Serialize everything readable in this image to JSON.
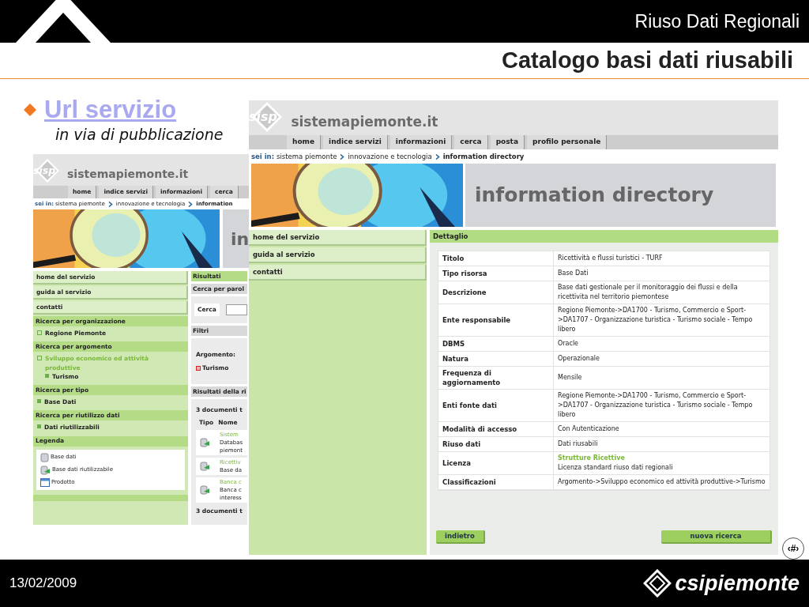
{
  "slide": {
    "header": "Riuso Dati Regionali",
    "title": "Catalogo basi dati riusabili",
    "bullet": {
      "link": "Url servizio",
      "note": "in via di pubblicazione"
    },
    "page_number": "‹#›",
    "date": "13/02/2009",
    "logo": "csipiemonte"
  },
  "back_page": {
    "logo_text": "sisp",
    "site_name": "sistemapiemonte.it",
    "nav": [
      "home",
      "indice servizi",
      "informazioni",
      "cerca"
    ],
    "breadcrumb": {
      "label": "sei in:",
      "items": [
        "sistema piemonte",
        "innovazione e tecnologia",
        "information"
      ]
    },
    "banner_title": "in",
    "menu": [
      "home del servizio",
      "guida al servizio",
      "contatti"
    ],
    "sections": [
      {
        "title": "Ricerca per organizzazione",
        "items": [
          {
            "label": "Regione Piemonte",
            "kind": "tree"
          }
        ]
      },
      {
        "title": "Ricerca per argomento",
        "items": [
          {
            "label": "Sviluppo economico ed attività produttive",
            "kind": "tree",
            "children": [
              {
                "label": "Turismo",
                "kind": "leaf"
              }
            ]
          }
        ]
      },
      {
        "title": "Ricerca per tipo",
        "items": [
          {
            "label": "Base Dati",
            "kind": "leaf"
          }
        ]
      },
      {
        "title": "Ricerca per riutilizzo dati",
        "items": [
          {
            "label": "Dati riutilizzabili",
            "kind": "leaf"
          }
        ]
      }
    ],
    "legend": {
      "title": "Legenda",
      "items": [
        {
          "label": "Base dati",
          "kind": "database"
        },
        {
          "label": "Base dati riutilizzabile",
          "kind": "reusable"
        },
        {
          "label": "Prodotto",
          "kind": "product"
        }
      ]
    },
    "results": {
      "title": "Risultati",
      "search_title": "Cerca per parol",
      "search_label": "Cerca",
      "filters_title": "Filtri",
      "filter_label": "Argomento:",
      "filter_value": "Turismo",
      "list_title": "Risultati della ri",
      "count": "3 documenti t",
      "columns": [
        "Tipo",
        "Nome"
      ],
      "rows": [
        {
          "title": "Sistem",
          "lines": [
            "Databas",
            "piemont"
          ]
        },
        {
          "title": "Ricettiv",
          "lines": [
            "Base da"
          ]
        },
        {
          "title": "Banca c",
          "lines": [
            "Banca c",
            "interess"
          ]
        }
      ],
      "footer": "3 documenti t"
    }
  },
  "front_page": {
    "logo_text": "sisp",
    "site_name": "sistemapiemonte.it",
    "nav": [
      "home",
      "indice servizi",
      "informazioni",
      "cerca",
      "posta",
      "profilo personale"
    ],
    "breadcrumb": {
      "label": "sei in:",
      "items": [
        "sistema piemonte",
        "innovazione e tecnologia",
        "information directory"
      ]
    },
    "banner_title": "information directory",
    "menu": [
      "home del servizio",
      "guida al servizio",
      "contatti"
    ],
    "detail": {
      "title": "Dettaglio",
      "rows": [
        {
          "label": "Titolo",
          "value": "Ricettività e flussi turistici - TURF"
        },
        {
          "label": "Tipo risorsa",
          "value": "Base Dati"
        },
        {
          "label": "Descrizione",
          "value": "Base dati gestionale per il monitoraggio dei flussi e della ricettivita nel territorio piemontese"
        },
        {
          "label": "Ente responsabile",
          "value": "Regione Piemonte->DA1700 - Turismo, Commercio e Sport->DA1707 - Organizzazione turistica - Turismo sociale - Tempo libero"
        },
        {
          "label": "DBMS",
          "value": "Oracle"
        },
        {
          "label": "Natura",
          "value": "Operazionale"
        },
        {
          "label": "Frequenza di aggiornamento",
          "value": "Mensile"
        },
        {
          "label": "Enti fonte dati",
          "value": "Regione Piemonte->DA1700 - Turismo, Commercio e Sport->DA1707 - Organizzazione turistica - Turismo sociale - Tempo libero"
        },
        {
          "label": "Modalità di accesso",
          "value": "Con Autenticazione"
        },
        {
          "label": "Riuso dati",
          "value": "Dati riusabili"
        },
        {
          "label": "Licenza",
          "link": "Strutture Ricettive",
          "value": "Licenza standard riuso dati regionali"
        },
        {
          "label": "Classificazioni",
          "value": "Argomento->Sviluppo economico ed attività produttive->Turismo"
        }
      ]
    },
    "buttons": [
      "indietro",
      "nuova ricerca"
    ]
  }
}
